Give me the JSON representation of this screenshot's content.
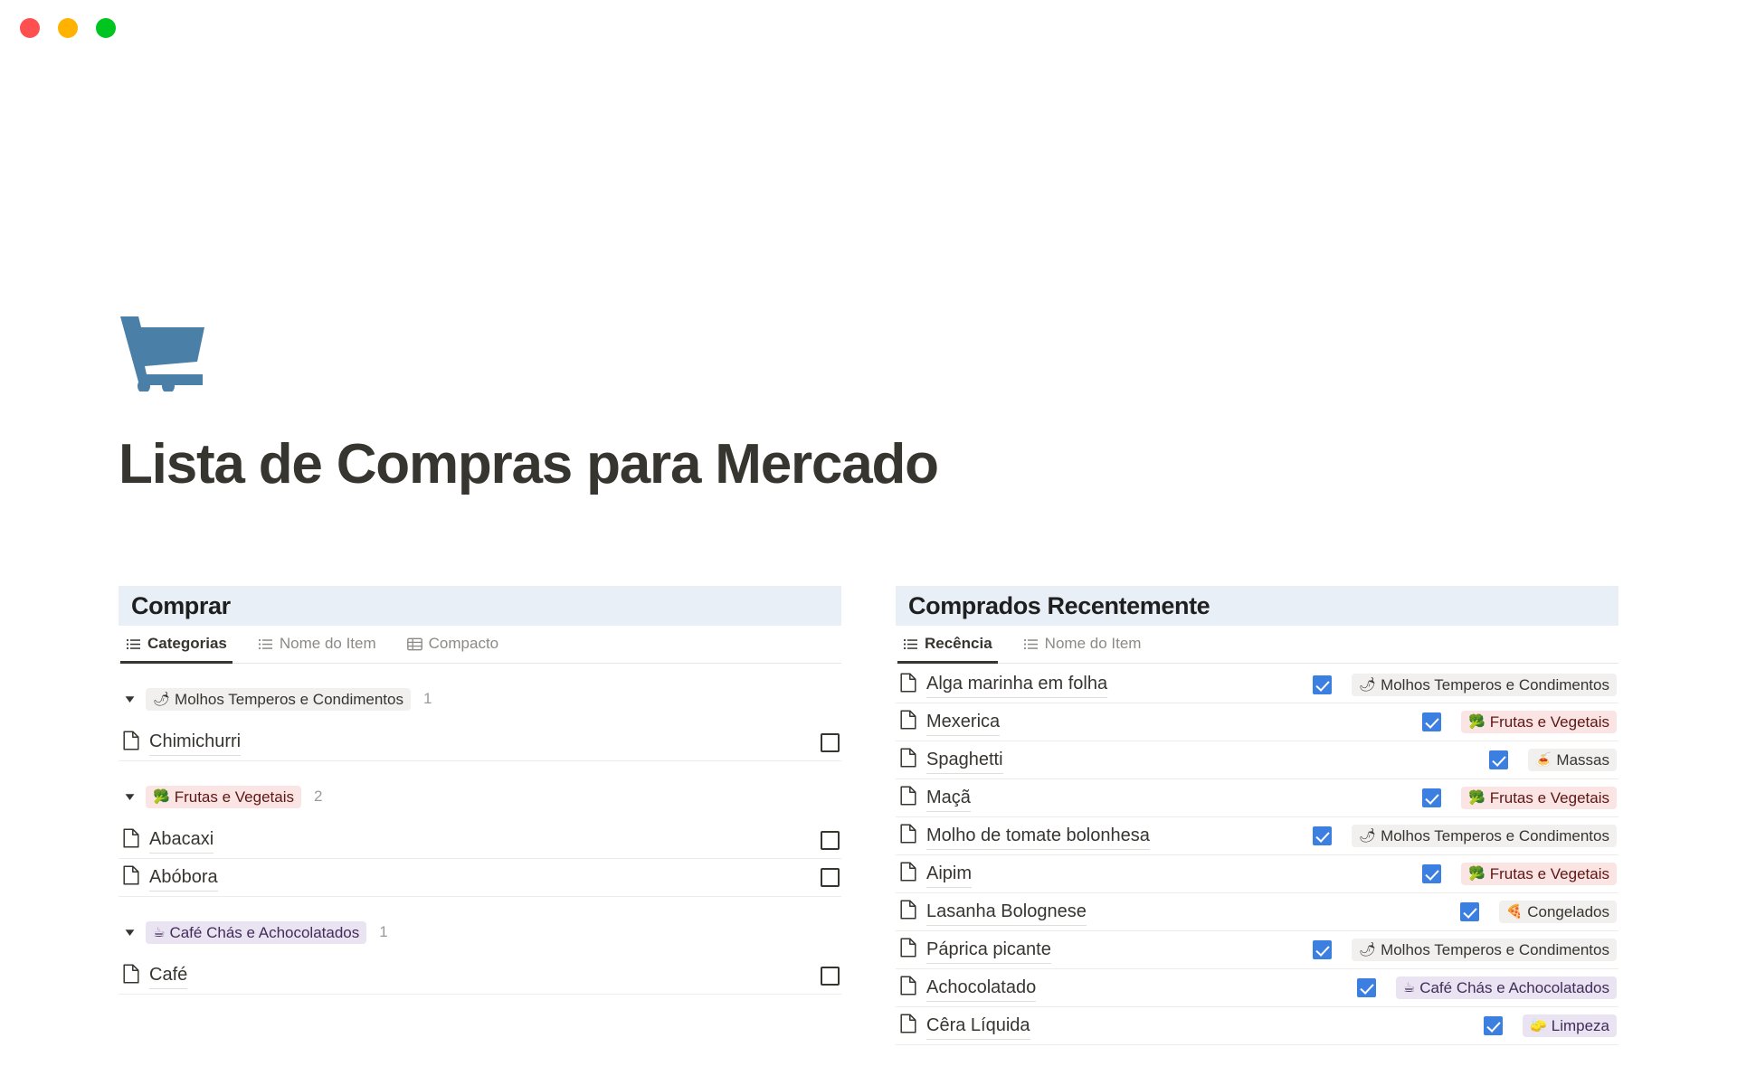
{
  "window": {
    "close_label": "close",
    "minimize_label": "minimize",
    "maximize_label": "maximize"
  },
  "hero": {
    "icon": "shopping-cart-icon",
    "title": "Lista de Compras para Mercado"
  },
  "panels": {
    "left": {
      "title": "Comprar",
      "tabs": [
        {
          "label": "Categorias",
          "icon": "list-view-icon",
          "active": true
        },
        {
          "label": "Nome do Item",
          "icon": "list-view-icon",
          "active": false
        },
        {
          "label": "Compacto",
          "icon": "table-view-icon",
          "active": false
        }
      ],
      "groups": [
        {
          "emoji": "🌶",
          "label": "Molhos Temperos e Condimentos",
          "tag_style": "tag-gray",
          "count": "1",
          "collapsed": false,
          "items": [
            {
              "name": "Chimichurri",
              "checked": false
            }
          ]
        },
        {
          "emoji": "🥦",
          "label": "Frutas e Vegetais",
          "tag_style": "tag-pink",
          "count": "2",
          "collapsed": false,
          "items": [
            {
              "name": "Abacaxi",
              "checked": false
            },
            {
              "name": "Abóbora",
              "checked": false
            }
          ]
        },
        {
          "emoji": "☕",
          "label": "Café Chás e Achocolatados",
          "tag_style": "tag-purple",
          "count": "1",
          "collapsed": false,
          "items": [
            {
              "name": "Café",
              "checked": false
            }
          ]
        }
      ]
    },
    "right": {
      "title": "Comprados Recentemente",
      "tabs": [
        {
          "label": "Recência",
          "icon": "list-view-icon",
          "active": true
        },
        {
          "label": "Nome do Item",
          "icon": "list-view-icon",
          "active": false
        }
      ],
      "rows": [
        {
          "name": "Alga marinha em folha",
          "checked": true,
          "tag_emoji": "🌶",
          "tag_label": "Molhos Temperos e Condimentos",
          "tag_style": "tag-gray"
        },
        {
          "name": "Mexerica",
          "checked": true,
          "tag_emoji": "🥦",
          "tag_label": "Frutas e Vegetais",
          "tag_style": "tag-pink"
        },
        {
          "name": "Spaghetti",
          "checked": true,
          "tag_emoji": "🍝",
          "tag_label": "Massas",
          "tag_style": "tag-gray"
        },
        {
          "name": "Maçã",
          "checked": true,
          "tag_emoji": "🥦",
          "tag_label": "Frutas e Vegetais",
          "tag_style": "tag-pink"
        },
        {
          "name": "Molho de tomate bolonhesa",
          "checked": true,
          "tag_emoji": "🌶",
          "tag_label": "Molhos Temperos e Condimentos",
          "tag_style": "tag-gray"
        },
        {
          "name": "Aipim",
          "checked": true,
          "tag_emoji": "🥦",
          "tag_label": "Frutas e Vegetais",
          "tag_style": "tag-pink"
        },
        {
          "name": "Lasanha Bolognese",
          "checked": true,
          "tag_emoji": "🍕",
          "tag_label": "Congelados",
          "tag_style": "tag-gray"
        },
        {
          "name": "Páprica picante",
          "checked": true,
          "tag_emoji": "🌶",
          "tag_label": "Molhos Temperos e Condimentos",
          "tag_style": "tag-gray"
        },
        {
          "name": "Achocolatado",
          "checked": true,
          "tag_emoji": "☕",
          "tag_label": "Café Chás e Achocolatados",
          "tag_style": "tag-purple"
        },
        {
          "name": "Cêra Líquida",
          "checked": true,
          "tag_emoji": "🧽",
          "tag_label": "Limpeza",
          "tag_style": "tag-purple"
        }
      ]
    }
  },
  "colors": {
    "panel_header_bg": "#E8EFF7",
    "checkbox_checked": "#3B7FE0",
    "text_primary": "#37352F",
    "text_muted": "#9B9A97",
    "cart_blue": "#4A7FA8",
    "tag_pink_bg": "#FBE4E4",
    "tag_purple_bg": "#EAE4F2",
    "tag_gray_bg": "#F1F0EF"
  }
}
